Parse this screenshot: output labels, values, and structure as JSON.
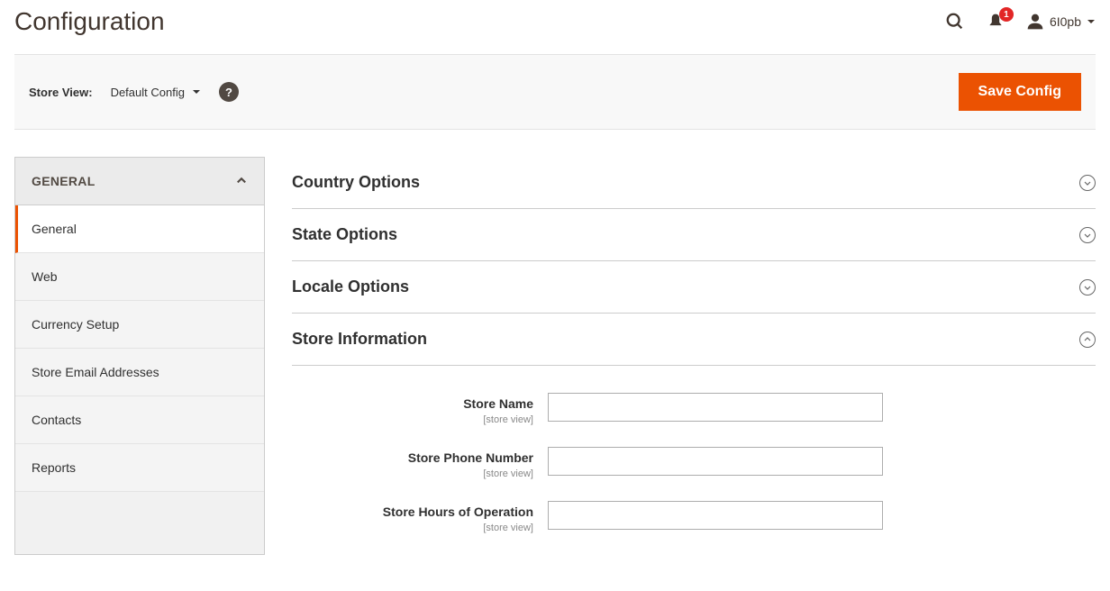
{
  "header": {
    "title": "Configuration",
    "user_name": "6I0pb",
    "notification_count": "1"
  },
  "toolbar": {
    "store_view_label": "Store View:",
    "store_view_value": "Default Config",
    "help_symbol": "?",
    "save_label": "Save Config"
  },
  "sidebar": {
    "group_title": "GENERAL",
    "items": [
      {
        "label": "General",
        "active": true
      },
      {
        "label": "Web",
        "active": false
      },
      {
        "label": "Currency Setup",
        "active": false
      },
      {
        "label": "Store Email Addresses",
        "active": false
      },
      {
        "label": "Contacts",
        "active": false
      },
      {
        "label": "Reports",
        "active": false
      }
    ]
  },
  "sections": [
    {
      "title": "Country Options",
      "expanded": false
    },
    {
      "title": "State Options",
      "expanded": false
    },
    {
      "title": "Locale Options",
      "expanded": false
    },
    {
      "title": "Store Information",
      "expanded": true
    }
  ],
  "store_info_fields": [
    {
      "label": "Store Name",
      "scope": "[store view]",
      "value": ""
    },
    {
      "label": "Store Phone Number",
      "scope": "[store view]",
      "value": ""
    },
    {
      "label": "Store Hours of Operation",
      "scope": "[store view]",
      "value": ""
    }
  ]
}
